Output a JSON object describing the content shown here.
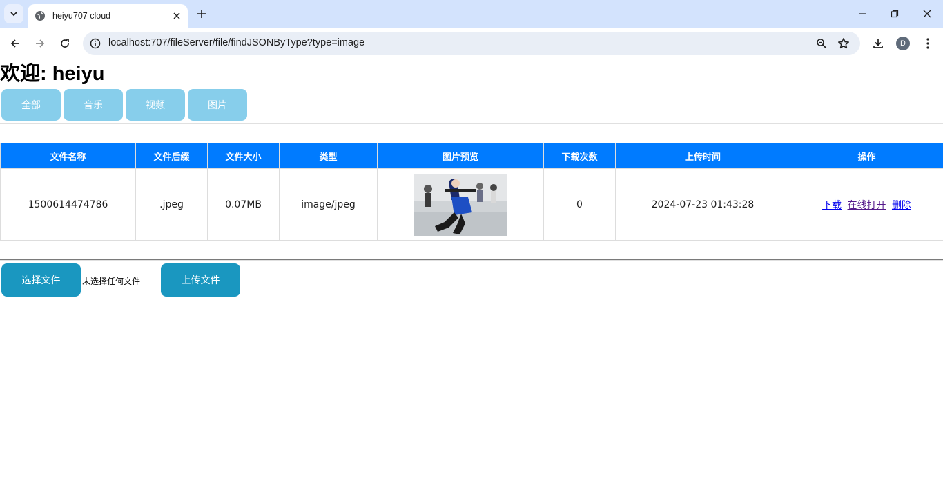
{
  "browser": {
    "tab_title": "heiyu707 cloud",
    "url": "localhost:707/fileServer/file/findJSONByType?type=image",
    "profile_initial": "D"
  },
  "page": {
    "welcome": "欢迎: heiyu",
    "categories": [
      {
        "label": "全部"
      },
      {
        "label": "音乐"
      },
      {
        "label": "视频"
      },
      {
        "label": "图片"
      }
    ],
    "table": {
      "headers": [
        "文件名称",
        "文件后缀",
        "文件大小",
        "类型",
        "图片预览",
        "下载次数",
        "上传时间",
        "操作"
      ],
      "rows": [
        {
          "name": "1500614474786",
          "ext": ".jpeg",
          "size": "0.07MB",
          "type": "image/jpeg",
          "downloads": "0",
          "uploaded": "2024-07-23 01:43:28",
          "actions": {
            "download": "下载",
            "open": "在线打开",
            "delete": "删除"
          }
        }
      ]
    },
    "upload": {
      "choose_label": "选择文件",
      "no_file_text": "未选择任何文件",
      "upload_label": "上传文件"
    }
  },
  "colors": {
    "header_bg": "#007bff",
    "category_btn": "#87ceeb",
    "upload_btn": "#1a97c0"
  }
}
